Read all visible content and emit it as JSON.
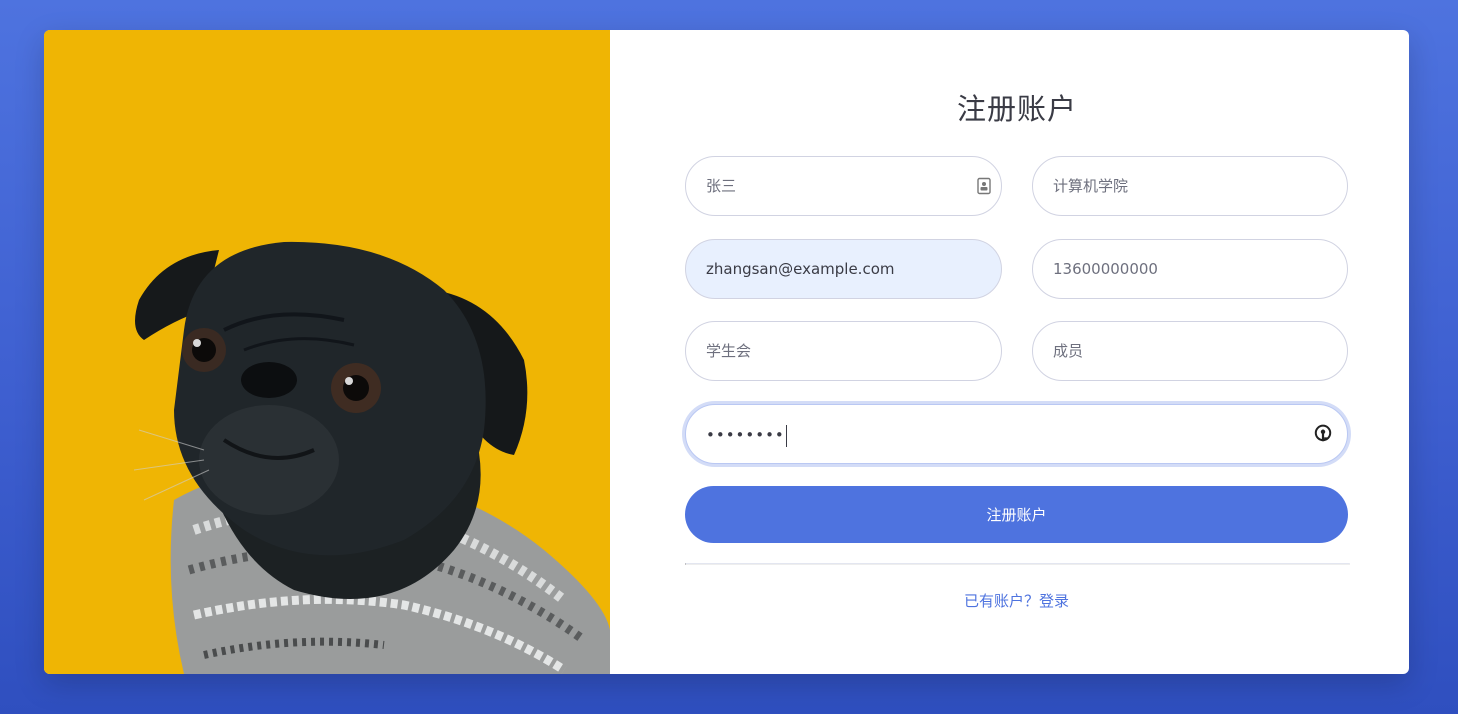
{
  "image_panel": {
    "subject": "black pug in knit sweater on yellow background",
    "background_color": "#efb504"
  },
  "form": {
    "title": "注册账户",
    "fields": {
      "name": {
        "placeholder": "张三",
        "value": ""
      },
      "college": {
        "placeholder": "计算机学院",
        "value": ""
      },
      "email": {
        "placeholder": "",
        "value": "zhangsan@example.com"
      },
      "phone": {
        "placeholder": "13600000000",
        "value": ""
      },
      "organization": {
        "placeholder": "学生会",
        "value": ""
      },
      "role": {
        "placeholder": "成员",
        "value": ""
      },
      "password": {
        "masked_value": "••••••••"
      }
    },
    "submit_label": "注册账户",
    "login_link_label": "已有账户？登录"
  },
  "colors": {
    "accent": "#4e73df",
    "page_background": "#4e73df",
    "autofill_background": "#e8f0fe",
    "field_border": "#d1d3e2",
    "title_text": "#3a3b45"
  },
  "icons": {
    "name_field": "contact-card-icon",
    "password_field": "password-manager-key-icon"
  }
}
